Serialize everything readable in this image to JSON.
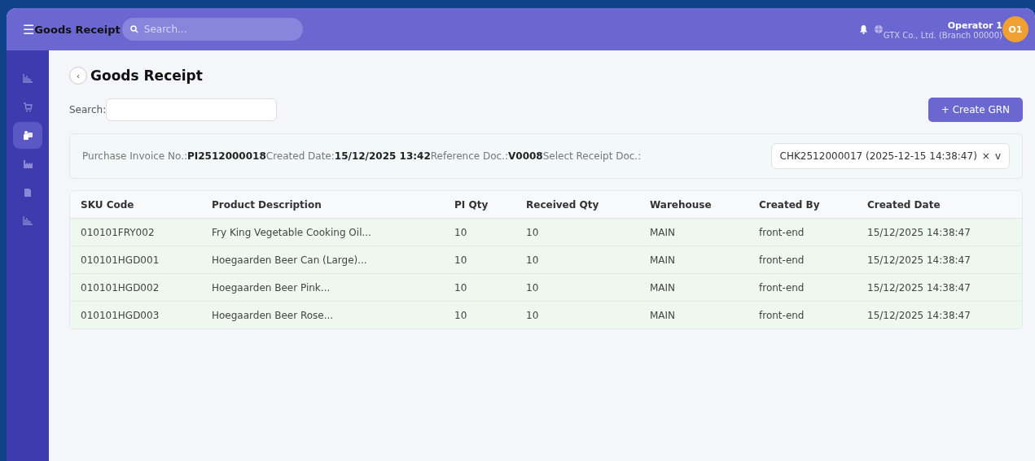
{
  "header": {
    "menu_glyph": "☰",
    "title": "Goods Receipt",
    "search": {
      "placeholder": "Search..."
    },
    "user": {
      "name": "Operator 1",
      "company": "GTX Co., Ltd. (Branch 00000)",
      "initials": "O1"
    }
  },
  "sidebar": {
    "items": [
      {
        "kind": "chart",
        "selected": false
      },
      {
        "kind": "cart",
        "selected": false
      },
      {
        "kind": "box",
        "selected": true
      },
      {
        "kind": "factory",
        "selected": false
      },
      {
        "kind": "doc",
        "selected": false
      },
      {
        "kind": "chart",
        "selected": false
      }
    ]
  },
  "page": {
    "back_glyph": "‹",
    "title": "Goods Receipt",
    "search": {
      "label": "Search:"
    },
    "create_button": "+ Create GRN"
  },
  "info": [
    {
      "label": "Purchase Invoice No.:",
      "value": "PI2512000018"
    },
    {
      "label": "Created Date:",
      "value": "15/12/2025 13:42"
    },
    {
      "label": "Reference Doc.:",
      "value": "V0008"
    }
  ],
  "receipt_select": {
    "label": "Select Receipt Doc.:",
    "value": "CHK2512000017 (2025-12-15 14:38:47)",
    "clear": "×",
    "caret": "v"
  },
  "table": {
    "columns": [
      "SKU Code",
      "Product Description",
      "PI Qty",
      "Received Qty",
      "Warehouse",
      "Created By",
      "Created Date"
    ],
    "rows": [
      [
        "010101FRY002",
        "Fry King Vegetable Cooking Oil...",
        "10",
        "10",
        "MAIN",
        "front-end",
        "15/12/2025 14:38:47"
      ],
      [
        "010101HGD001",
        "Hoegaarden Beer Can (Large)...",
        "10",
        "10",
        "MAIN",
        "front-end",
        "15/12/2025 14:38:47"
      ],
      [
        "010101HGD002",
        "Hoegaarden Beer Pink...",
        "10",
        "10",
        "MAIN",
        "front-end",
        "15/12/2025 14:38:47"
      ],
      [
        "010101HGD003",
        "Hoegaarden Beer Rose...",
        "10",
        "10",
        "MAIN",
        "front-end",
        "15/12/2025 14:38:47"
      ]
    ]
  }
}
